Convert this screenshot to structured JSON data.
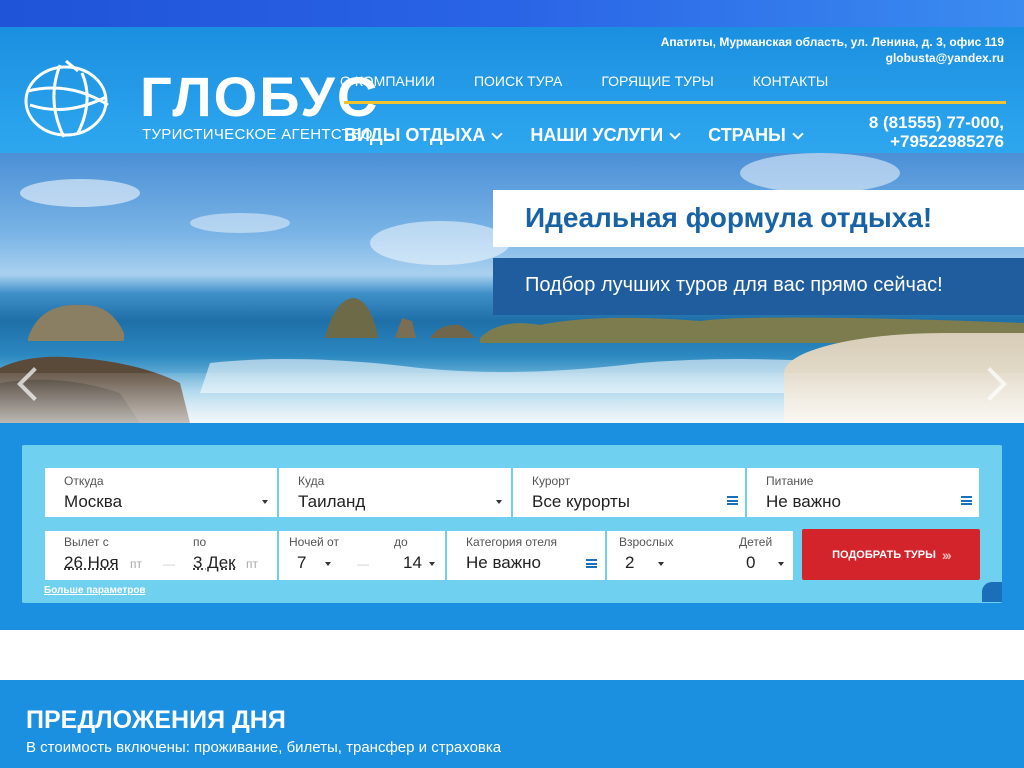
{
  "brand": {
    "name": "ГЛОБУС",
    "tagline": "ТУРИСТИЧЕСКОЕ АГЕНТСТВО"
  },
  "contacts": {
    "address": "Апатиты, Мурманская область, ул. Ленина, д. 3, офис 119",
    "email": "globusta@yandex.ru",
    "phone_line1": "8 (81555) 77-000,",
    "phone_line2": "+79522985276"
  },
  "top_nav": [
    "О КОМПАНИИ",
    "ПОИСК ТУРА",
    "ГОРЯЩИЕ ТУРЫ",
    "КОНТАКТЫ"
  ],
  "main_nav": [
    "ВИДЫ ОТДЫХА",
    "НАШИ УСЛУГИ",
    "СТРАНЫ"
  ],
  "hero": {
    "title": "Идеальная формула отдыха!",
    "subtitle": "Подбор лучших туров для вас прямо сейчас!"
  },
  "search": {
    "from": {
      "label": "Откуда",
      "value": "Москва"
    },
    "to": {
      "label": "Куда",
      "value": "Таиланд"
    },
    "resort": {
      "label": "Курорт",
      "value": "Все курорты"
    },
    "meal": {
      "label": "Питание",
      "value": "Не важно"
    },
    "depart_from": {
      "label": "Вылет с",
      "value": "26 Ноя",
      "dow": "пт"
    },
    "depart_to": {
      "label": "по",
      "value": "3 Дек",
      "dow": "пт"
    },
    "nights_from": {
      "label": "Ночей от",
      "value": "7"
    },
    "nights_to": {
      "label": "до",
      "value": "14"
    },
    "hotel_category": {
      "label": "Категория отеля",
      "value": "Не важно"
    },
    "adults": {
      "label": "Взрослых",
      "value": "2"
    },
    "children": {
      "label": "Детей",
      "value": "0"
    },
    "submit_label": "ПОДОБРАТЬ ТУРЫ",
    "more_params": "Больше параметров",
    "dash": "—"
  },
  "offers": {
    "title": "ПРЕДЛОЖЕНИЯ ДНЯ",
    "subtitle": "В стоимость включены: проживание, билеты, трансфер и страховка"
  },
  "colors": {
    "header_blue": "#1b8fe0",
    "accent_yellow": "#f2c230",
    "submit_red": "#d3242c",
    "promo_blue": "#1f5d9e"
  }
}
